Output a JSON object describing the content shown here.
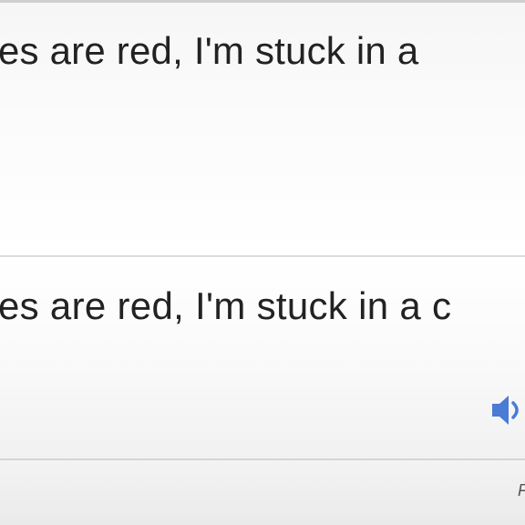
{
  "source": {
    "text": "es are red, I'm stuck in a",
    "overflow_text": "."
  },
  "translation": {
    "text": "es are red, I'm stuck in a c"
  },
  "listen_button": {
    "icon": "speaker-icon",
    "color": "#4a7bd5"
  },
  "footer": {
    "link_text": "F"
  }
}
